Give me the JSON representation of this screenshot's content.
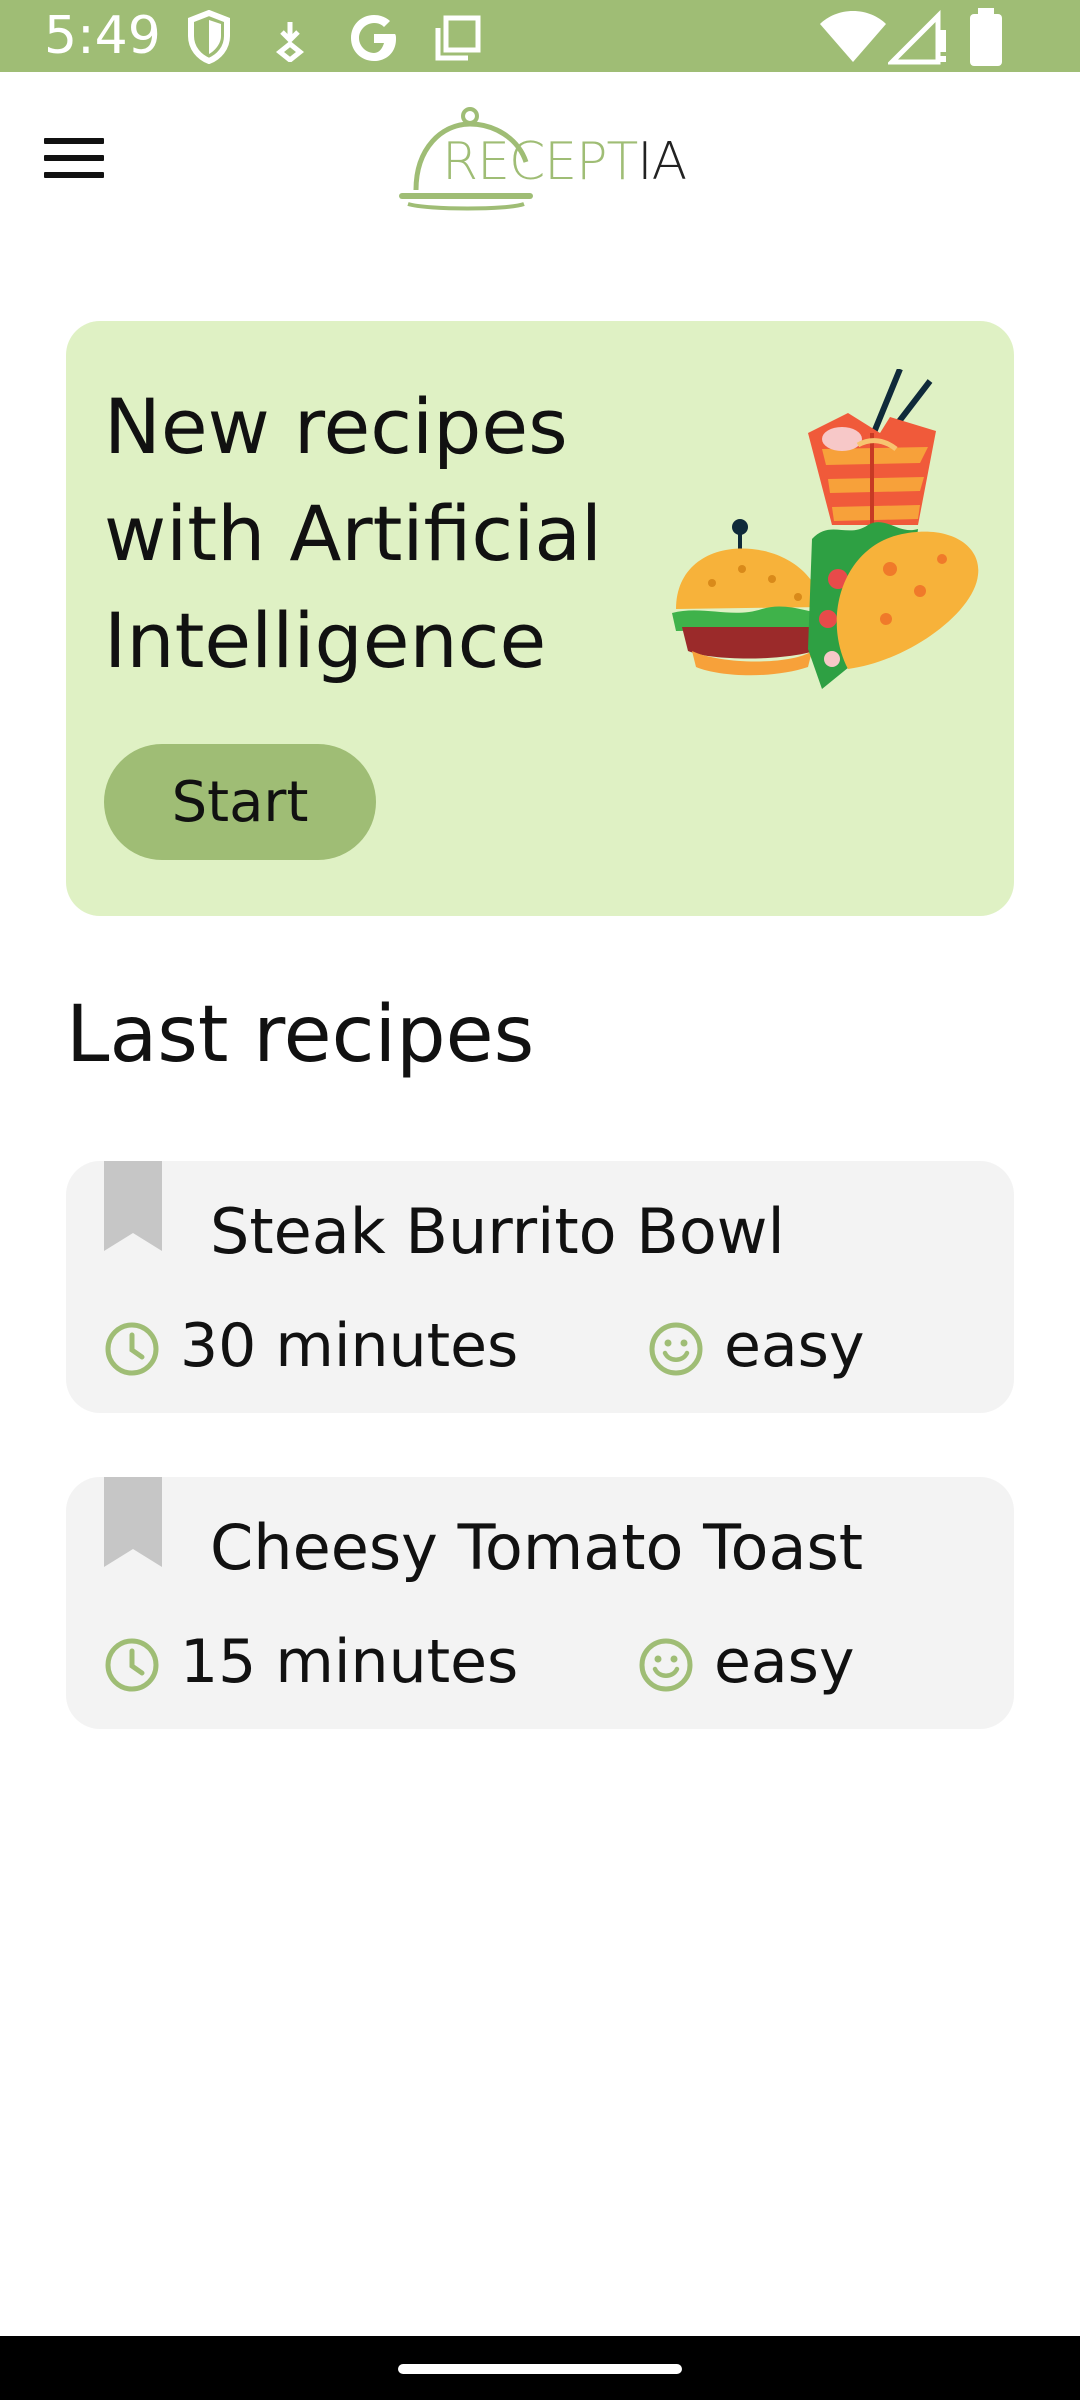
{
  "status_bar": {
    "time": "5:49",
    "left_icons": [
      "shield-icon",
      "download-icon",
      "google-icon",
      "copy-icon"
    ],
    "right_icons": [
      "wifi-icon",
      "signal-icon",
      "battery-icon"
    ],
    "background_color": "#9fbd75"
  },
  "app_bar": {
    "menu_icon": "hamburger-menu-icon",
    "logo_text_primary": "RECEPT",
    "logo_text_secondary": "IA"
  },
  "hero": {
    "title": "New recipes with Artificial Intelligence",
    "button_label": "Start",
    "background_color": "#dff1c4",
    "button_color": "#9fbd75"
  },
  "recipes_section": {
    "title": "Last recipes",
    "items": [
      {
        "title": "Steak Burrito Bowl",
        "time": "30 minutes",
        "difficulty": "easy"
      },
      {
        "title": "Cheesy Tomato Toast",
        "time": "15 minutes",
        "difficulty": "easy"
      }
    ]
  },
  "accent_color": "#9fbd75"
}
